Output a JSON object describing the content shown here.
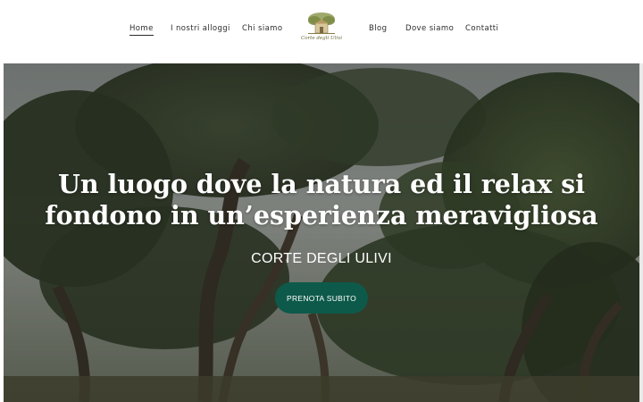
{
  "nav": {
    "left": [
      "Home",
      "I nostri alloggi",
      "Chi siamo"
    ],
    "right": [
      "Blog",
      "Dove siamo",
      "Contatti"
    ],
    "active": "Home"
  },
  "logo": {
    "text": "Corte degli Ulivi",
    "icon": "olive-tree-house-icon"
  },
  "hero": {
    "title_line1": "Un luogo dove la natura ed il relax si",
    "title_line2": "fondono in un’esperienza meravigliosa",
    "subtitle": "CORTE DEGLI ULIVI",
    "cta_label": "PRENOTA SUBITO"
  },
  "colors": {
    "cta": "#0e5a4a",
    "nav_text": "#2b2b2b",
    "logo": "#6b6a3a"
  }
}
